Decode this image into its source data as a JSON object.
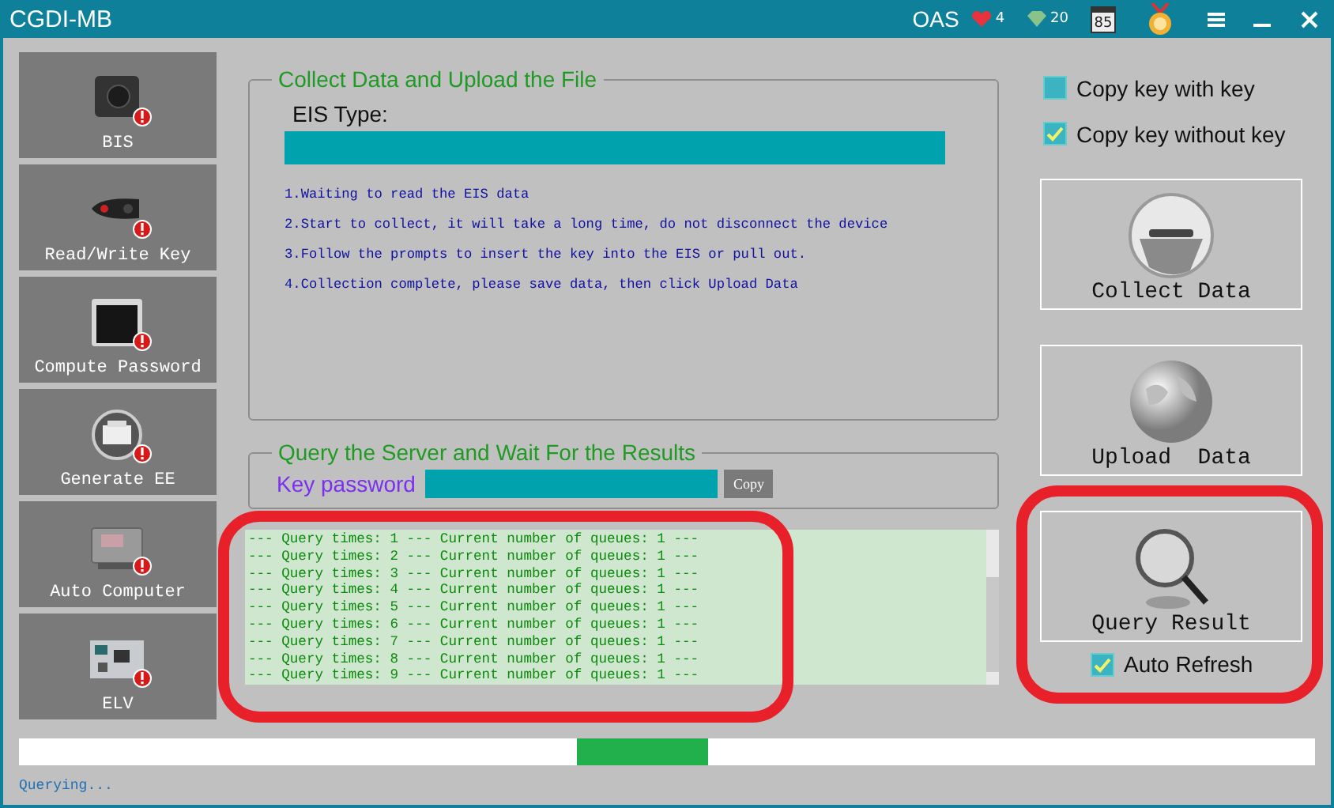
{
  "window": {
    "title": "CGDI-MB"
  },
  "header": {
    "account": "OAS",
    "hearts": "4",
    "gems": "20",
    "calendar_day": "85"
  },
  "sidebar": {
    "items": [
      {
        "label": "BIS",
        "kind": "lock"
      },
      {
        "label": "Read/Write Key",
        "kind": "key"
      },
      {
        "label": "Compute Password",
        "kind": "screen"
      },
      {
        "label": "Generate EE",
        "kind": "printer"
      },
      {
        "label": "Auto Computer",
        "kind": "ecu"
      },
      {
        "label": "ELV",
        "kind": "board"
      }
    ]
  },
  "collect_panel": {
    "title": "Collect Data and Upload the File",
    "eis_type_label": "EIS Type:",
    "steps": [
      "1.Waiting to read the EIS data",
      "2.Start to collect, it will take a long time, do not disconnect the device",
      "3.Follow the prompts to insert the key into the EIS or pull out.",
      "4.Collection complete, please save data, then click Upload Data"
    ]
  },
  "query_panel": {
    "title": "Query the Server and Wait For the Results",
    "key_password_label": "Key password",
    "copy_button": "Copy"
  },
  "log": {
    "lines": [
      "--- Query times: 1 --- Current number of queues: 1 ---",
      "--- Query times: 2 --- Current number of queues: 1 ---",
      "--- Query times: 3 --- Current number of queues: 1 ---",
      "--- Query times: 4 --- Current number of queues: 1 ---",
      "--- Query times: 5 --- Current number of queues: 1 ---",
      "--- Query times: 6 --- Current number of queues: 1 ---",
      "--- Query times: 7 --- Current number of queues: 1 ---",
      "--- Query times: 8 --- Current number of queues: 1 ---",
      "--- Query times: 9 --- Current number of queues: 1 ---"
    ]
  },
  "options": [
    {
      "label": "Copy key with key",
      "checked": false
    },
    {
      "label": "Copy key without key",
      "checked": true
    }
  ],
  "actions": [
    {
      "label": "Collect Data",
      "kind": "collect"
    },
    {
      "label": "Upload  Data",
      "kind": "upload"
    },
    {
      "label": "Query Result",
      "kind": "query"
    }
  ],
  "auto_refresh": {
    "label": "Auto Refresh",
    "checked": true
  },
  "progress": {
    "busy": true
  },
  "status": "Querying..."
}
